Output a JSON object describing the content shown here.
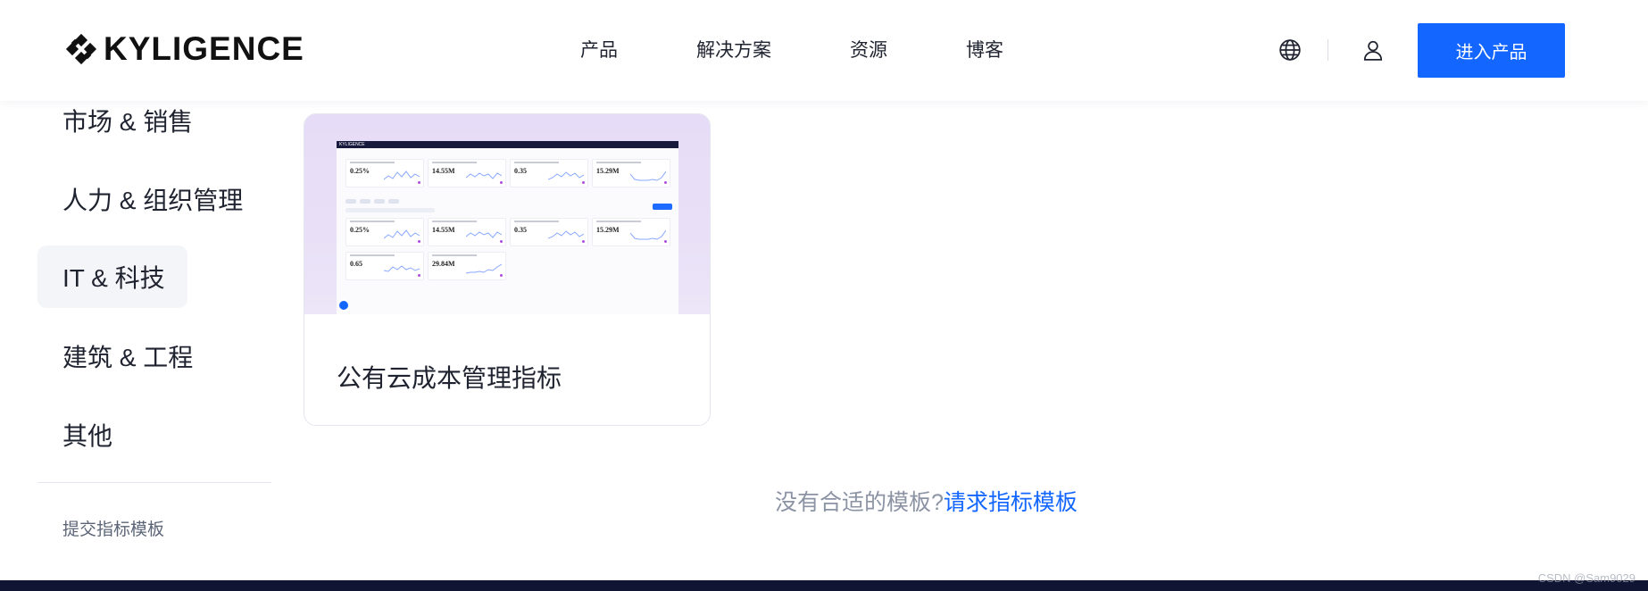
{
  "header": {
    "logo_text": "KYLIGENCE",
    "nav": [
      {
        "label": "产品"
      },
      {
        "label": "解决方案"
      },
      {
        "label": "资源"
      },
      {
        "label": "博客"
      }
    ],
    "cta_label": "进入产品",
    "accent_color": "#1366ff"
  },
  "sidebar": {
    "items": [
      {
        "label": "市场 & 销售",
        "active": false
      },
      {
        "label": "人力 & 组织管理",
        "active": false
      },
      {
        "label": "IT & 科技",
        "active": true
      },
      {
        "label": "建筑 & 工程",
        "active": false
      },
      {
        "label": "其他",
        "active": false
      }
    ],
    "submit_label": "提交指标模板"
  },
  "cards": [
    {
      "title": "公有云成本管理指标",
      "preview": {
        "brand": "KYLIGENCE",
        "metrics": [
          "0.25%",
          "14.55M",
          "0.35",
          "15.29M",
          "0.25%",
          "14.55M",
          "0.35",
          "15.29M",
          "0.65",
          "29.84M"
        ]
      }
    }
  ],
  "request": {
    "text": "没有合适的模板?",
    "link_label": "请求指标模板"
  },
  "watermark": "CSDN @Sam9029",
  "icons": {
    "language": "globe-icon",
    "account": "user-icon"
  }
}
